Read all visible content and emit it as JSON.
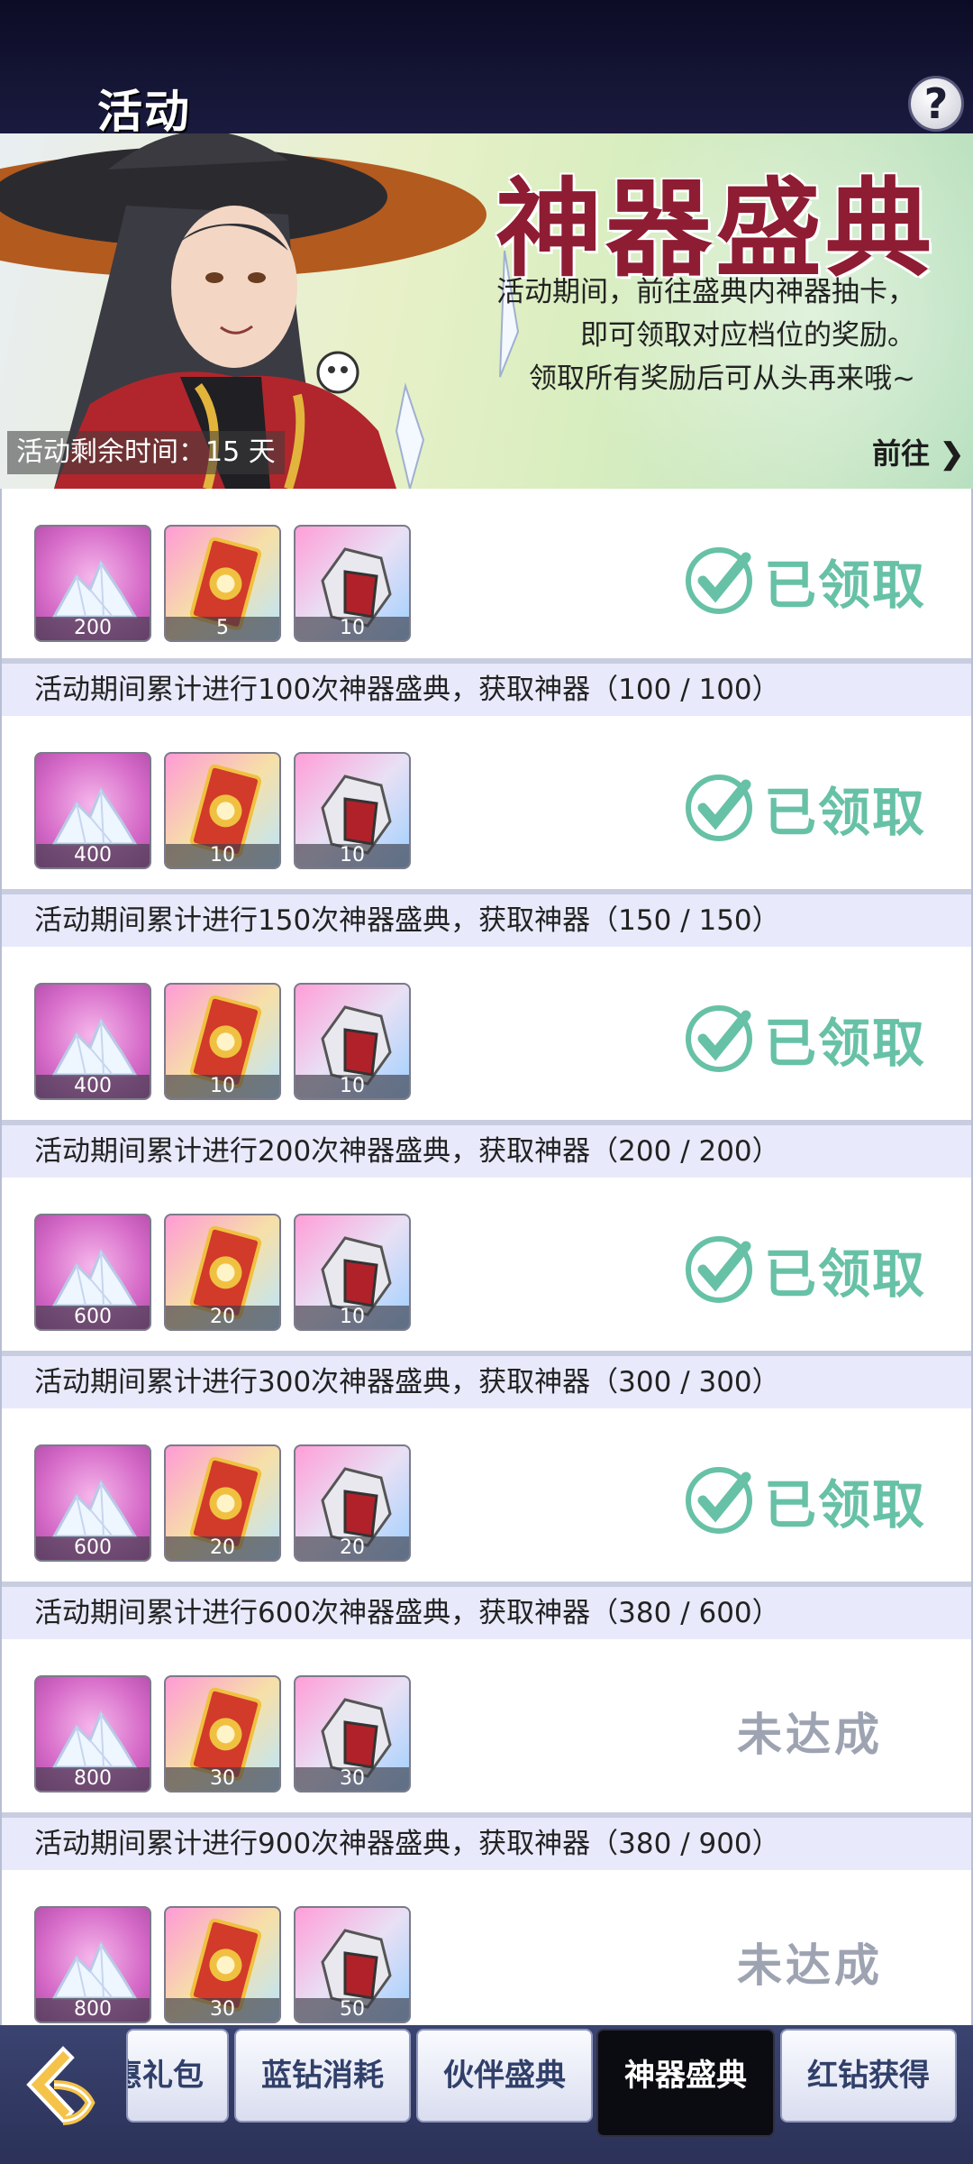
{
  "header": {
    "title": "活动",
    "help_label": "?"
  },
  "banner": {
    "title": "神器盛典",
    "desc_line1": "活动期间，前往盛典内神器抽卡，",
    "desc_line2": "即可领取对应档位的奖励。",
    "desc_line3": "领取所有奖励后可从头再来哦~",
    "timer": "活动剩余时间：15 天",
    "goto": "前往"
  },
  "status_labels": {
    "claimed": "已领取",
    "pending": "未达成"
  },
  "rows": [
    {
      "header": "",
      "items": [
        "200",
        "5",
        "10"
      ],
      "status": "已领取"
    },
    {
      "header": "活动期间累计进行100次神器盛典，获取神器（100 / 100）",
      "items": [
        "400",
        "10",
        "10"
      ],
      "status": "已领取"
    },
    {
      "header": "活动期间累计进行150次神器盛典，获取神器（150 / 150）",
      "items": [
        "400",
        "10",
        "10"
      ],
      "status": "已领取"
    },
    {
      "header": "活动期间累计进行200次神器盛典，获取神器（200 / 200）",
      "items": [
        "600",
        "20",
        "10"
      ],
      "status": "已领取"
    },
    {
      "header": "活动期间累计进行300次神器盛典，获取神器（300 / 300）",
      "items": [
        "600",
        "20",
        "20"
      ],
      "status": "已领取"
    },
    {
      "header": "活动期间累计进行600次神器盛典，获取神器（380 / 600）",
      "items": [
        "800",
        "30",
        "30"
      ],
      "status": "未达成"
    },
    {
      "header": "活动期间累计进行900次神器盛典，获取神器（380 / 900）",
      "items": [
        "800",
        "30",
        "50"
      ],
      "status": "未达成"
    }
  ],
  "tabs": [
    {
      "label": "惠礼包",
      "active": false
    },
    {
      "label": "蓝钻消耗",
      "active": false
    },
    {
      "label": "伙伴盛典",
      "active": false
    },
    {
      "label": "神器盛典",
      "active": true
    },
    {
      "label": "红钻获得",
      "active": false
    }
  ],
  "icons": {
    "back": "back-arrow-icon",
    "crystal": "crystal-icon",
    "card": "summon-card-icon",
    "fragment": "artifact-fragment-icon",
    "check": "check-icon"
  },
  "colors": {
    "claimed": "#67c1a6",
    "pending": "#9ea3b2",
    "title": "#8e1c33"
  }
}
